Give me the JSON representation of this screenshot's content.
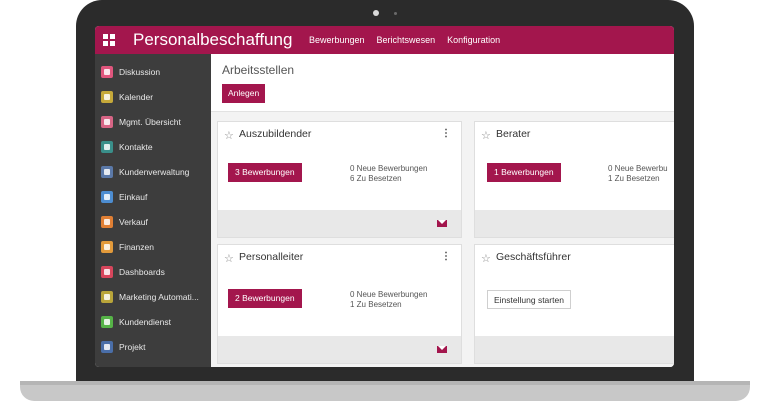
{
  "app": {
    "title": "Personalbeschaffung",
    "nav": [
      "Bewerbungen",
      "Berichtswesen",
      "Konfiguration"
    ],
    "accent": "#a3164d"
  },
  "sidebar": {
    "items": [
      {
        "label": "Diskussion",
        "icon": "chat-icon",
        "color": "#e0567d"
      },
      {
        "label": "Kalender",
        "icon": "calendar-icon",
        "color": "#c6a93a"
      },
      {
        "label": "Mgmt. Übersicht",
        "icon": "chart-icon",
        "color": "#d76585"
      },
      {
        "label": "Kontakte",
        "icon": "contact-icon",
        "color": "#3a8f8a"
      },
      {
        "label": "Kundenverwaltung",
        "icon": "crm-icon",
        "color": "#5b79a8"
      },
      {
        "label": "Einkauf",
        "icon": "purchase-icon",
        "color": "#4d8dd1"
      },
      {
        "label": "Verkauf",
        "icon": "sales-icon",
        "color": "#e07f34"
      },
      {
        "label": "Finanzen",
        "icon": "invoice-icon",
        "color": "#e29a3b"
      },
      {
        "label": "Dashboards",
        "icon": "dashboard-icon",
        "color": "#d7465c"
      },
      {
        "label": "Marketing Automati...",
        "icon": "marketing-icon",
        "color": "#b9a53a"
      },
      {
        "label": "Kundendienst",
        "icon": "helpdesk-icon",
        "color": "#56b347"
      },
      {
        "label": "Projekt",
        "icon": "project-icon",
        "color": "#4a6ea8"
      }
    ]
  },
  "main": {
    "title": "Arbeitsstellen",
    "create_label": "Anlegen"
  },
  "jobs": [
    {
      "title": "Auszubildender",
      "button": "3 Bewerbungen",
      "new_applications": "0 Neue Bewerbungen",
      "to_fill": "6 Zu Besetzen"
    },
    {
      "title": "Berater",
      "button": "1 Bewerbungen",
      "new_applications": "0 Neue Bewerbu",
      "to_fill": "1 Zu Besetzen"
    },
    {
      "title": "Personalleiter",
      "button": "2 Bewerbungen",
      "new_applications": "0 Neue Bewerbungen",
      "to_fill": "1 Zu Besetzen"
    },
    {
      "title": "Geschäftsführer",
      "button": "Einstellung starten"
    }
  ]
}
